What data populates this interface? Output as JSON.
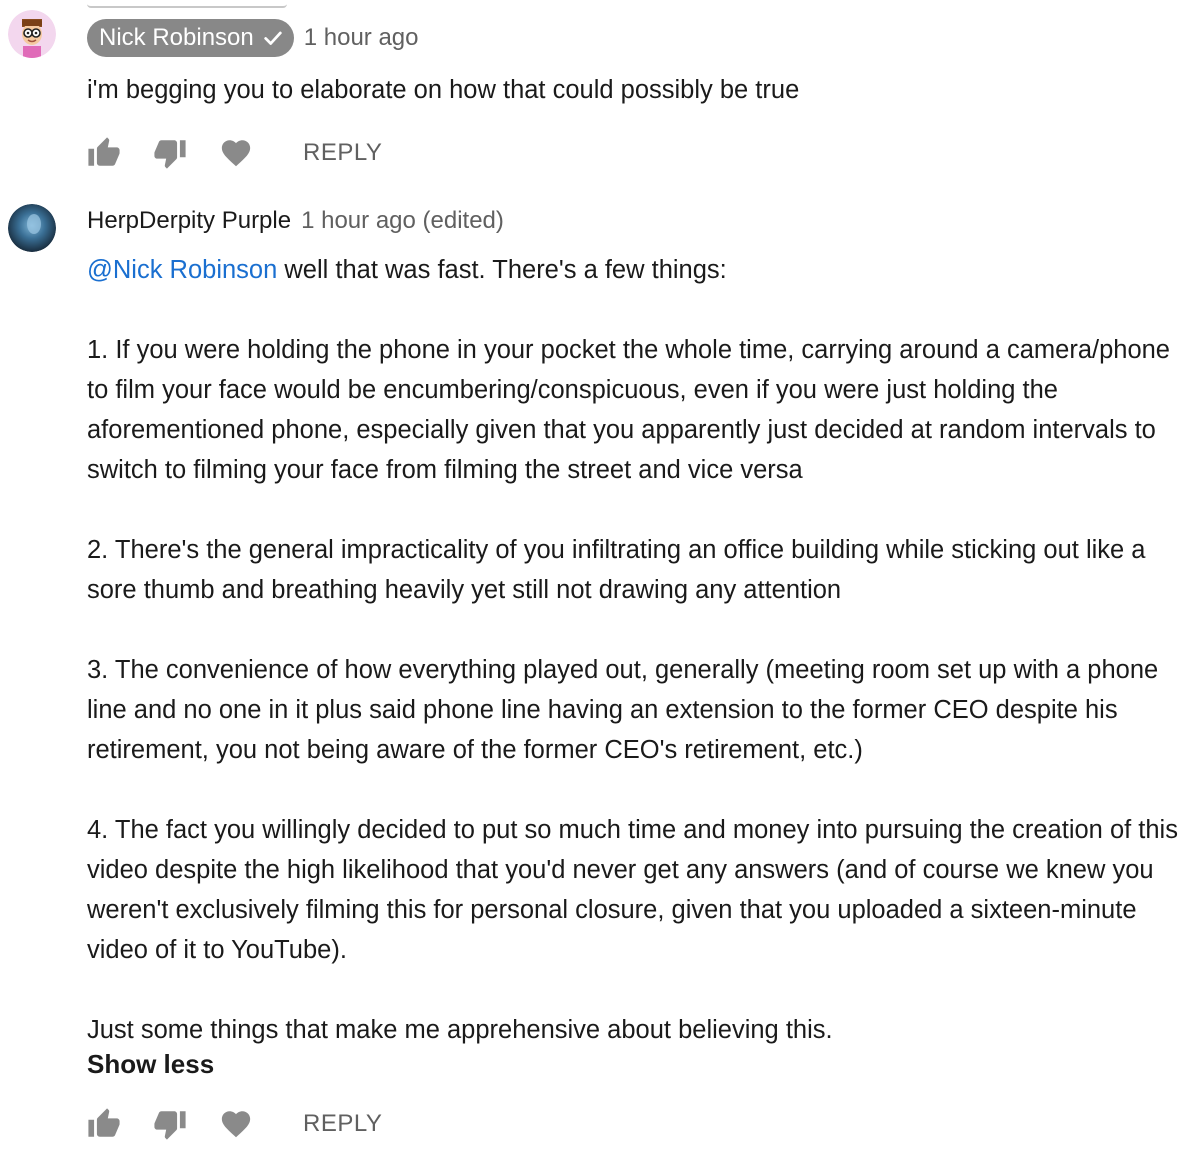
{
  "comments": [
    {
      "author": "Nick Robinson",
      "author_is_owner": true,
      "time": "1 hour ago",
      "text": "i'm begging you to elaborate on how that could possibly be true",
      "reply_label": "REPLY",
      "icons": [
        "avatar-cartoon",
        "thumbs-up-icon",
        "thumbs-down-icon",
        "heart-icon"
      ]
    },
    {
      "author": "HerpDerpity Purple",
      "time": "1 hour ago (edited)",
      "mention": "@Nick Robinson",
      "intro": " well that was fast. There's a few things:",
      "paragraphs": [
        "1. If you were holding the phone in your pocket the whole time, carrying around a camera/phone to film your face would be encumbering/conspicuous, even if you were just holding the aforementioned phone, especially given that you apparently just decided at random intervals to switch to filming your face from filming the street and vice versa",
        "2. There's the general impracticality of you infiltrating an office building while sticking out like a sore thumb and breathing heavily yet still not drawing any attention",
        "3. The convenience of how everything played out, generally (meeting room set up with a phone line and no one in it plus said phone line having an extension to the former CEO despite his retirement, you not being aware of the former CEO's retirement,  etc.)",
        "4. The fact you willingly decided to put so much time and money into pursuing the creation of this video despite the high likelihood that you'd never get any answers (and of course we knew you weren't exclusively filming this for personal closure, given that you uploaded a sixteen-minute video of it to YouTube).",
        "Just some things that make me apprehensive about believing this."
      ],
      "show_less_label": "Show less",
      "reply_label": "REPLY"
    }
  ],
  "colors": {
    "owner_chip_bg": "#888888",
    "mention": "#1a6fd0",
    "muted_text": "#606060",
    "icon_gray": "#8a8a8a"
  }
}
